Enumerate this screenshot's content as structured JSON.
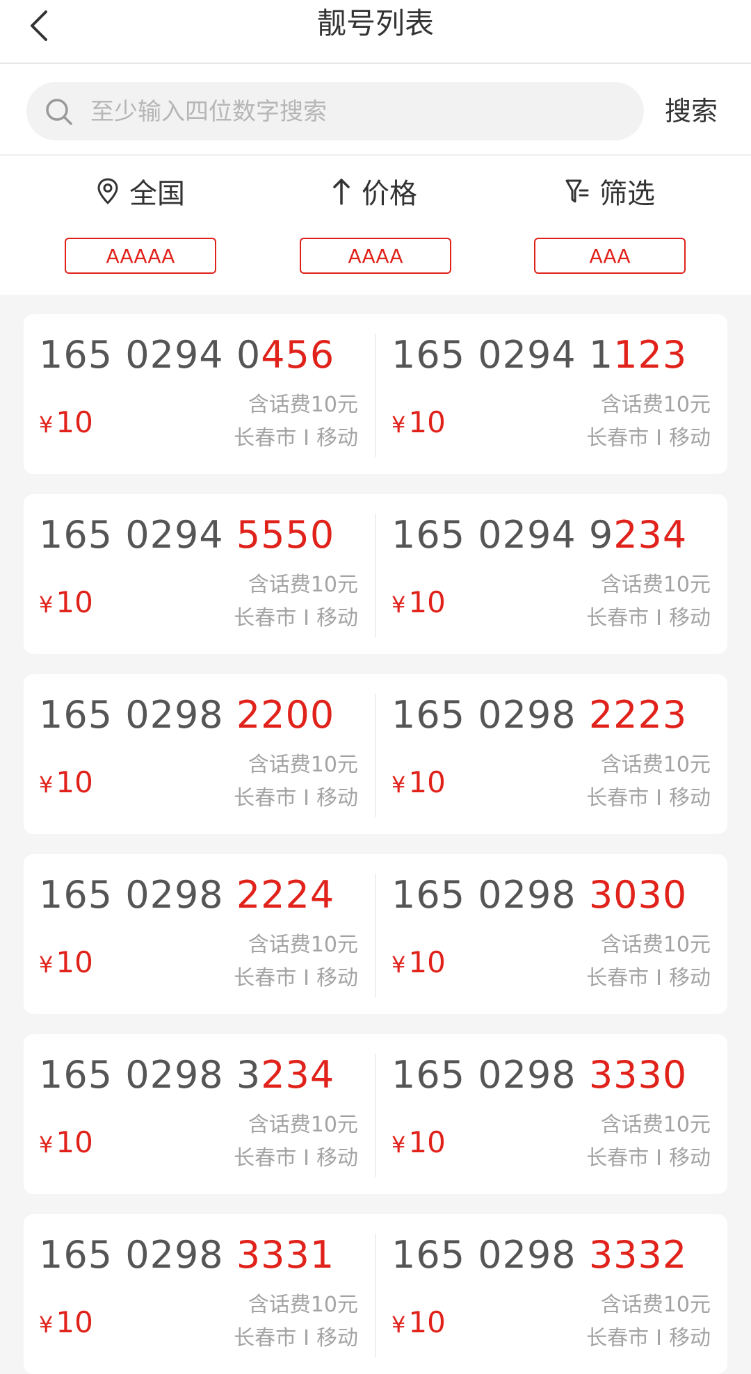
{
  "header": {
    "title": "靓号列表",
    "back_icon": "chevron-left-icon"
  },
  "search": {
    "placeholder": "至少输入四位数字搜索",
    "button_label": "搜索",
    "icon": "search-icon"
  },
  "filters": {
    "region": {
      "label": "全国",
      "icon": "location-pin-icon"
    },
    "price": {
      "label": "价格",
      "icon": "arrow-up-icon"
    },
    "screen": {
      "label": "筛选",
      "icon": "filter-icon"
    }
  },
  "tags": [
    "AAAAA",
    "AAAA",
    "AAA"
  ],
  "colors": {
    "accent": "#e0221b",
    "number_text": "#555555",
    "muted": "#a3a3a3",
    "background": "#f5f5f5"
  },
  "numbers": [
    {
      "prefix": "165 0294 0",
      "highlight": "456",
      "price": "10",
      "currency": "¥",
      "fee": "含话费10元",
      "city": "长春市",
      "separator": "I",
      "carrier": "移动"
    },
    {
      "prefix": "165 0294 1",
      "highlight": "123",
      "price": "10",
      "currency": "¥",
      "fee": "含话费10元",
      "city": "长春市",
      "separator": "I",
      "carrier": "移动"
    },
    {
      "prefix": "165 0294 ",
      "highlight": "5550",
      "price": "10",
      "currency": "¥",
      "fee": "含话费10元",
      "city": "长春市",
      "separator": "I",
      "carrier": "移动"
    },
    {
      "prefix": "165 0294 9",
      "highlight": "234",
      "price": "10",
      "currency": "¥",
      "fee": "含话费10元",
      "city": "长春市",
      "separator": "I",
      "carrier": "移动"
    },
    {
      "prefix": "165 0298 ",
      "highlight": "2200",
      "price": "10",
      "currency": "¥",
      "fee": "含话费10元",
      "city": "长春市",
      "separator": "I",
      "carrier": "移动"
    },
    {
      "prefix": "165 0298 ",
      "highlight": "2223",
      "price": "10",
      "currency": "¥",
      "fee": "含话费10元",
      "city": "长春市",
      "separator": "I",
      "carrier": "移动"
    },
    {
      "prefix": "165 0298 ",
      "highlight": "2224",
      "price": "10",
      "currency": "¥",
      "fee": "含话费10元",
      "city": "长春市",
      "separator": "I",
      "carrier": "移动"
    },
    {
      "prefix": "165 0298 ",
      "highlight": "3030",
      "price": "10",
      "currency": "¥",
      "fee": "含话费10元",
      "city": "长春市",
      "separator": "I",
      "carrier": "移动"
    },
    {
      "prefix": "165 0298 3",
      "highlight": "234",
      "price": "10",
      "currency": "¥",
      "fee": "含话费10元",
      "city": "长春市",
      "separator": "I",
      "carrier": "移动"
    },
    {
      "prefix": "165 0298 ",
      "highlight": "3330",
      "price": "10",
      "currency": "¥",
      "fee": "含话费10元",
      "city": "长春市",
      "separator": "I",
      "carrier": "移动"
    },
    {
      "prefix": "165 0298 ",
      "highlight": "3331",
      "price": "10",
      "currency": "¥",
      "fee": "含话费10元",
      "city": "长春市",
      "separator": "I",
      "carrier": "移动"
    },
    {
      "prefix": "165 0298 ",
      "highlight": "3332",
      "price": "10",
      "currency": "¥",
      "fee": "含话费10元",
      "city": "长春市",
      "separator": "I",
      "carrier": "移动"
    }
  ]
}
